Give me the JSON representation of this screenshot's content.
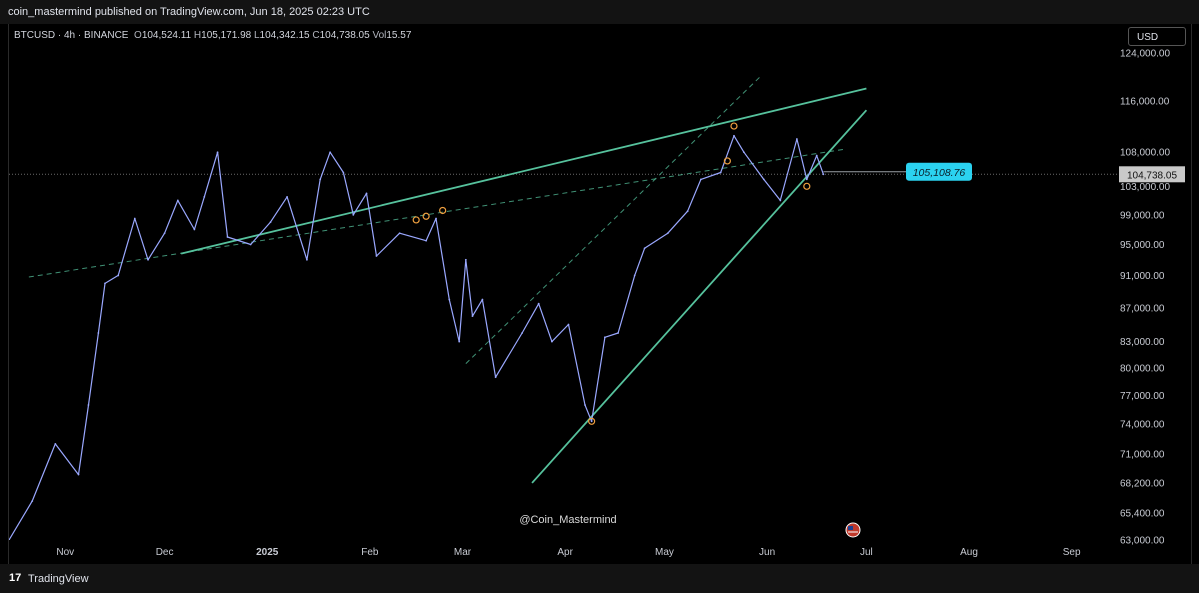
{
  "header": {
    "published": "coin_mastermind published on TradingView.com, Jun 18, 2025 02:23 UTC"
  },
  "legend": {
    "symbol": "BTCUSD · 4h · BINANCE",
    "o_label": "O",
    "o": "104,524.11",
    "h_label": "H",
    "h": "105,171.98",
    "l_label": "L",
    "l": "104,342.15",
    "c_label": "C",
    "c": "104,738.05",
    "vol_label": "Vol",
    "vol": "15.57"
  },
  "currency_button": "USD",
  "watermark": "@Coin_Mastermind",
  "footer": {
    "logo": "17",
    "brand": "TradingView"
  },
  "colors": {
    "price_line": "#9aa8ff",
    "trend": "#56c29d",
    "marker": "#f0a040",
    "badge": "#2bd2f0",
    "background": "#000000"
  },
  "chart_data": {
    "type": "line",
    "symbol": "BTCUSD",
    "interval": "4h",
    "exchange": "BINANCE",
    "y_scale": "log",
    "ylim": [
      63000,
      128000
    ],
    "y_ticks": [
      63000,
      65400,
      68200,
      71000,
      74000,
      77000,
      80000,
      83000,
      87000,
      91000,
      95000,
      99000,
      103000,
      108000,
      116000,
      124000
    ],
    "y_tick_labels": [
      "63,000.00",
      "65,400.00",
      "68,200.00",
      "71,000.00",
      "74,000.00",
      "77,000.00",
      "80,000.00",
      "83,000.00",
      "87,000.00",
      "91,000.00",
      "95,000.00",
      "99,000.00",
      "103,000.00",
      "108,000.00",
      "116,000.00",
      "124,000.00"
    ],
    "x_range": [
      "2024-10-15",
      "2025-09-15"
    ],
    "x_ticks": [
      {
        "date": "2024-11-01",
        "label": "Nov"
      },
      {
        "date": "2024-12-01",
        "label": "Dec"
      },
      {
        "date": "2025-01-01",
        "label": "2025"
      },
      {
        "date": "2025-02-01",
        "label": "Feb"
      },
      {
        "date": "2025-03-01",
        "label": "Mar"
      },
      {
        "date": "2025-04-01",
        "label": "Apr"
      },
      {
        "date": "2025-05-01",
        "label": "May"
      },
      {
        "date": "2025-06-01",
        "label": "Jun"
      },
      {
        "date": "2025-07-01",
        "label": "Jul"
      },
      {
        "date": "2025-08-01",
        "label": "Aug"
      },
      {
        "date": "2025-09-01",
        "label": "Sep"
      }
    ],
    "series": [
      {
        "x": [
          "2024-10-15",
          "2024-10-22",
          "2024-10-29",
          "2024-11-05",
          "2024-11-08",
          "2024-11-11",
          "2024-11-13",
          "2024-11-17",
          "2024-11-22",
          "2024-11-26",
          "2024-12-01",
          "2024-12-05",
          "2024-12-10",
          "2024-12-13",
          "2024-12-17",
          "2024-12-20",
          "2024-12-27",
          "2025-01-02",
          "2025-01-07",
          "2025-01-13",
          "2025-01-17",
          "2025-01-20",
          "2025-01-24",
          "2025-01-27",
          "2025-01-31",
          "2025-02-03",
          "2025-02-10",
          "2025-02-18",
          "2025-02-21",
          "2025-02-25",
          "2025-02-28",
          "2025-03-02",
          "2025-03-04",
          "2025-03-07",
          "2025-03-11",
          "2025-03-19",
          "2025-03-24",
          "2025-03-28",
          "2025-04-02",
          "2025-04-07",
          "2025-04-09",
          "2025-04-13",
          "2025-04-17",
          "2025-04-22",
          "2025-04-25",
          "2025-05-02",
          "2025-05-08",
          "2025-05-12",
          "2025-05-18",
          "2025-05-22",
          "2025-05-25",
          "2025-05-31",
          "2025-06-05",
          "2025-06-10",
          "2025-06-13",
          "2025-06-16",
          "2025-06-18"
        ],
        "y": [
          63000,
          66500,
          72000,
          69000,
          76000,
          84000,
          90000,
          91000,
          98500,
          93000,
          96500,
          101000,
          97000,
          101500,
          108000,
          96000,
          95000,
          98000,
          101500,
          93000,
          104000,
          108000,
          105000,
          99000,
          102000,
          93500,
          96500,
          95500,
          98500,
          88000,
          83000,
          93000,
          86000,
          88000,
          79000,
          84000,
          87500,
          83000,
          85000,
          76000,
          74300,
          83500,
          84000,
          91000,
          94500,
          96500,
          99500,
          104000,
          105000,
          110500,
          108000,
          104000,
          101000,
          110000,
          104000,
          107500,
          104738
        ]
      }
    ],
    "trendlines": [
      {
        "style": "solid",
        "from": [
          "2024-12-06",
          93800
        ],
        "to": [
          "2025-07-01",
          118000
        ]
      },
      {
        "style": "solid",
        "from": [
          "2025-03-22",
          68200
        ],
        "to": [
          "2025-07-01",
          114500
        ]
      },
      {
        "style": "dashed",
        "from": [
          "2024-10-21",
          90800
        ],
        "to": [
          "2025-06-25",
          108500
        ]
      },
      {
        "style": "dashed",
        "from": [
          "2025-03-02",
          80500
        ],
        "to": [
          "2025-05-30",
          120000
        ]
      }
    ],
    "markers": [
      [
        "2025-02-15",
        98300
      ],
      [
        "2025-02-18",
        98800
      ],
      [
        "2025-02-23",
        99600
      ],
      [
        "2025-04-09",
        74300
      ],
      [
        "2025-05-20",
        106700
      ],
      [
        "2025-05-22",
        112000
      ],
      [
        "2025-06-13",
        103000
      ]
    ],
    "price_label": "105,108.76",
    "price_label_value": 105108.76,
    "last_price": "104,738.05",
    "last_value": 104738.05
  }
}
